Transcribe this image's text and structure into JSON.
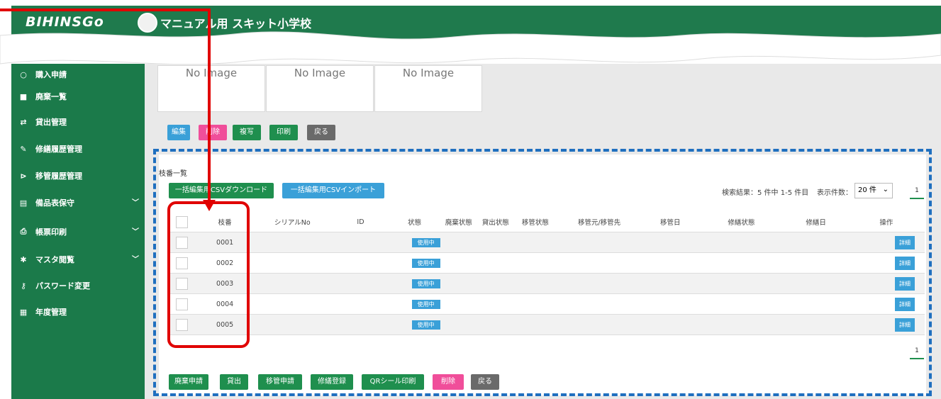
{
  "header": {
    "logo": "BIHINSGo",
    "school_name": "マニュアル用 スキット小学校"
  },
  "sidebar": {
    "items": [
      {
        "label": "購入申請",
        "icon": "circle-icon",
        "chevron": false
      },
      {
        "label": "廃棄一覧",
        "icon": "trash-icon",
        "chevron": false
      },
      {
        "label": "貸出管理",
        "icon": "swap-icon",
        "chevron": false
      },
      {
        "label": "修繕履歴管理",
        "icon": "wrench-icon",
        "chevron": false
      },
      {
        "label": "移管履歴管理",
        "icon": "handcart-icon",
        "chevron": false
      },
      {
        "label": "備品表保守",
        "icon": "table-icon",
        "chevron": true
      },
      {
        "label": "帳票印刷",
        "icon": "printer-icon",
        "chevron": true
      },
      {
        "label": "マスタ閲覧",
        "icon": "gear-icon",
        "chevron": true
      },
      {
        "label": "パスワード変更",
        "icon": "key-icon",
        "chevron": false
      },
      {
        "label": "年度管理",
        "icon": "calendar-icon",
        "chevron": false
      }
    ]
  },
  "images": {
    "no_image": "No Image"
  },
  "top_actions": {
    "edit": "編集",
    "delete": "削除",
    "copy": "複写",
    "print": "印刷",
    "back": "戻る"
  },
  "panel": {
    "title": "枝番一覧",
    "csv_download": "一括編集用CSVダウンロード",
    "csv_import": "一括編集用CSVインポート",
    "search_result": "検索結果：5 件中 1-5 件目",
    "per_page_label": "表示件数：",
    "per_page_value": "20 件",
    "page": "1"
  },
  "table": {
    "headers": [
      "枝番",
      "シリアルNo",
      "ID",
      "状態",
      "廃棄状態",
      "貸出状態",
      "移管状態",
      "移管元/移管先",
      "移管日",
      "修繕状態",
      "修繕日",
      "操作"
    ],
    "status_label": "使用中",
    "detail_label": "詳細",
    "rows": [
      "0001",
      "0002",
      "0003",
      "0004",
      "0005"
    ]
  },
  "bottom_actions": {
    "disposal_request": "廃棄申請",
    "lend": "貸出",
    "transfer_request": "移管申請",
    "repair_register": "修繕登録",
    "qr_print": "QRシール印刷",
    "delete": "削除",
    "back": "戻る"
  },
  "colors": {
    "brand_green": "#1f7a4d",
    "accent_blue": "#3aa0d8",
    "delete_pink": "#f04e9a",
    "annotation_red": "#e00000",
    "annotation_blue": "#1f6fbf"
  }
}
